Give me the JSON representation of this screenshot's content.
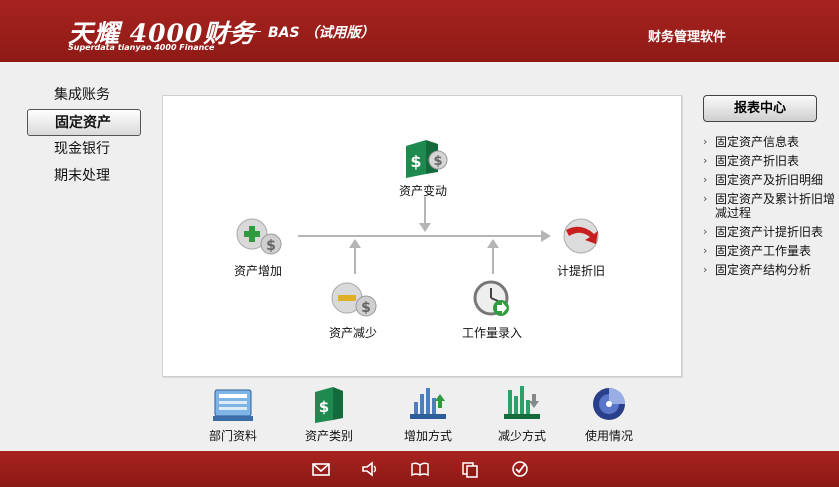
{
  "header": {
    "logo_text": "天耀 4000财务",
    "logo_sub": "Superdata tianyao 4000 Finance",
    "edition": "BAS （试用版）",
    "right_title": "财务管理软件"
  },
  "nav": {
    "items": [
      {
        "label": "集成账务"
      },
      {
        "label": "固定资产"
      },
      {
        "label": "现金银行"
      },
      {
        "label": "期末处理"
      }
    ],
    "active": "固定资产"
  },
  "flow": {
    "change": "资产变动",
    "add": "资产增加",
    "reduce": "资产减少",
    "workload": "工作量录入",
    "depreciation": "计提折旧"
  },
  "reports": {
    "title": "报表中心",
    "items": [
      {
        "label": "固定资产信息表"
      },
      {
        "label": "固定资产折旧表"
      },
      {
        "label": "固定资产及折旧明细"
      },
      {
        "label": "固定资产及累计折旧增减过程"
      },
      {
        "label": "固定资产计提折旧表"
      },
      {
        "label": "固定资产工作量表"
      },
      {
        "label": "固定资产结构分析"
      }
    ]
  },
  "tools": {
    "dept": "部门资料",
    "category": "资产类别",
    "increase_method": "增加方式",
    "decrease_method": "减少方式",
    "usage": "使用情况"
  },
  "footer_icons": [
    "mail-icon",
    "speaker-icon",
    "book-icon",
    "copy-icon",
    "check-icon"
  ]
}
